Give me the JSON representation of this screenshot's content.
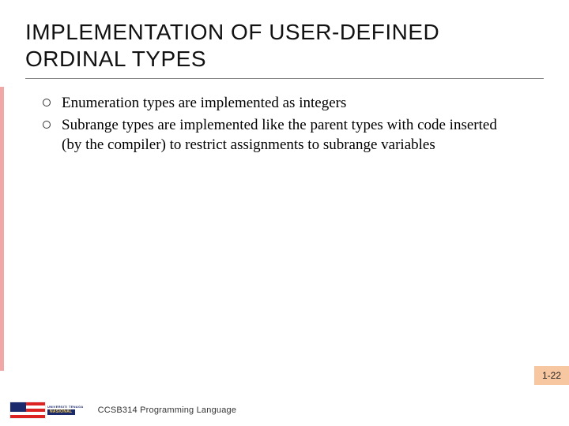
{
  "title": "IMPLEMENTATION OF USER-DEFINED ORDINAL TYPES",
  "bullets": [
    "Enumeration types are implemented as integers",
    "Subrange types are implemented like the parent types with code inserted (by the compiler) to restrict assignments to subrange variables"
  ],
  "page_number": "1-22",
  "footer": {
    "course": "CCSB314 Programming Language",
    "logo_top": "UNIVERSITI TENAGA",
    "logo_bottom": "NASIONAL"
  }
}
